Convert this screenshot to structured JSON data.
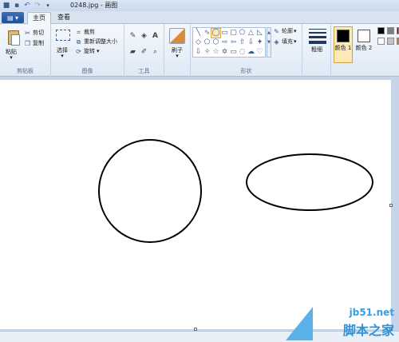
{
  "window": {
    "title": "0248.jpg - 画图"
  },
  "tabs": [
    {
      "label": "主页"
    },
    {
      "label": "查看"
    }
  ],
  "ribbon": {
    "clipboard": {
      "group_label": "剪贴板",
      "paste": "粘贴",
      "cut": "剪切",
      "copy": "复制"
    },
    "image": {
      "group_label": "图像",
      "select": "选择",
      "crop": "裁剪",
      "resize": "重新调整大小",
      "rotate": "旋转"
    },
    "tools": {
      "group_label": "工具"
    },
    "brushes": {
      "label": "刷子"
    },
    "shapes": {
      "group_label": "形状",
      "outline": "轮廓",
      "fill": "填充"
    },
    "size": {
      "label": "粗细"
    },
    "colors": {
      "color1": "颜色 1",
      "color2": "颜色 2",
      "color1_value": "#000000",
      "color2_value": "#ffffff",
      "palette": [
        "#000000",
        "#7f7f7f",
        "#880015",
        "#c3c3c3",
        "#b97a57",
        "#ffffff"
      ]
    }
  },
  "canvas": {
    "background": "#ffffff",
    "shapes": [
      {
        "type": "circle",
        "stroke": "#000000"
      },
      {
        "type": "ellipse",
        "stroke": "#000000"
      }
    ]
  },
  "watermark": {
    "site": "jb51.net",
    "name": "脚本之家"
  }
}
